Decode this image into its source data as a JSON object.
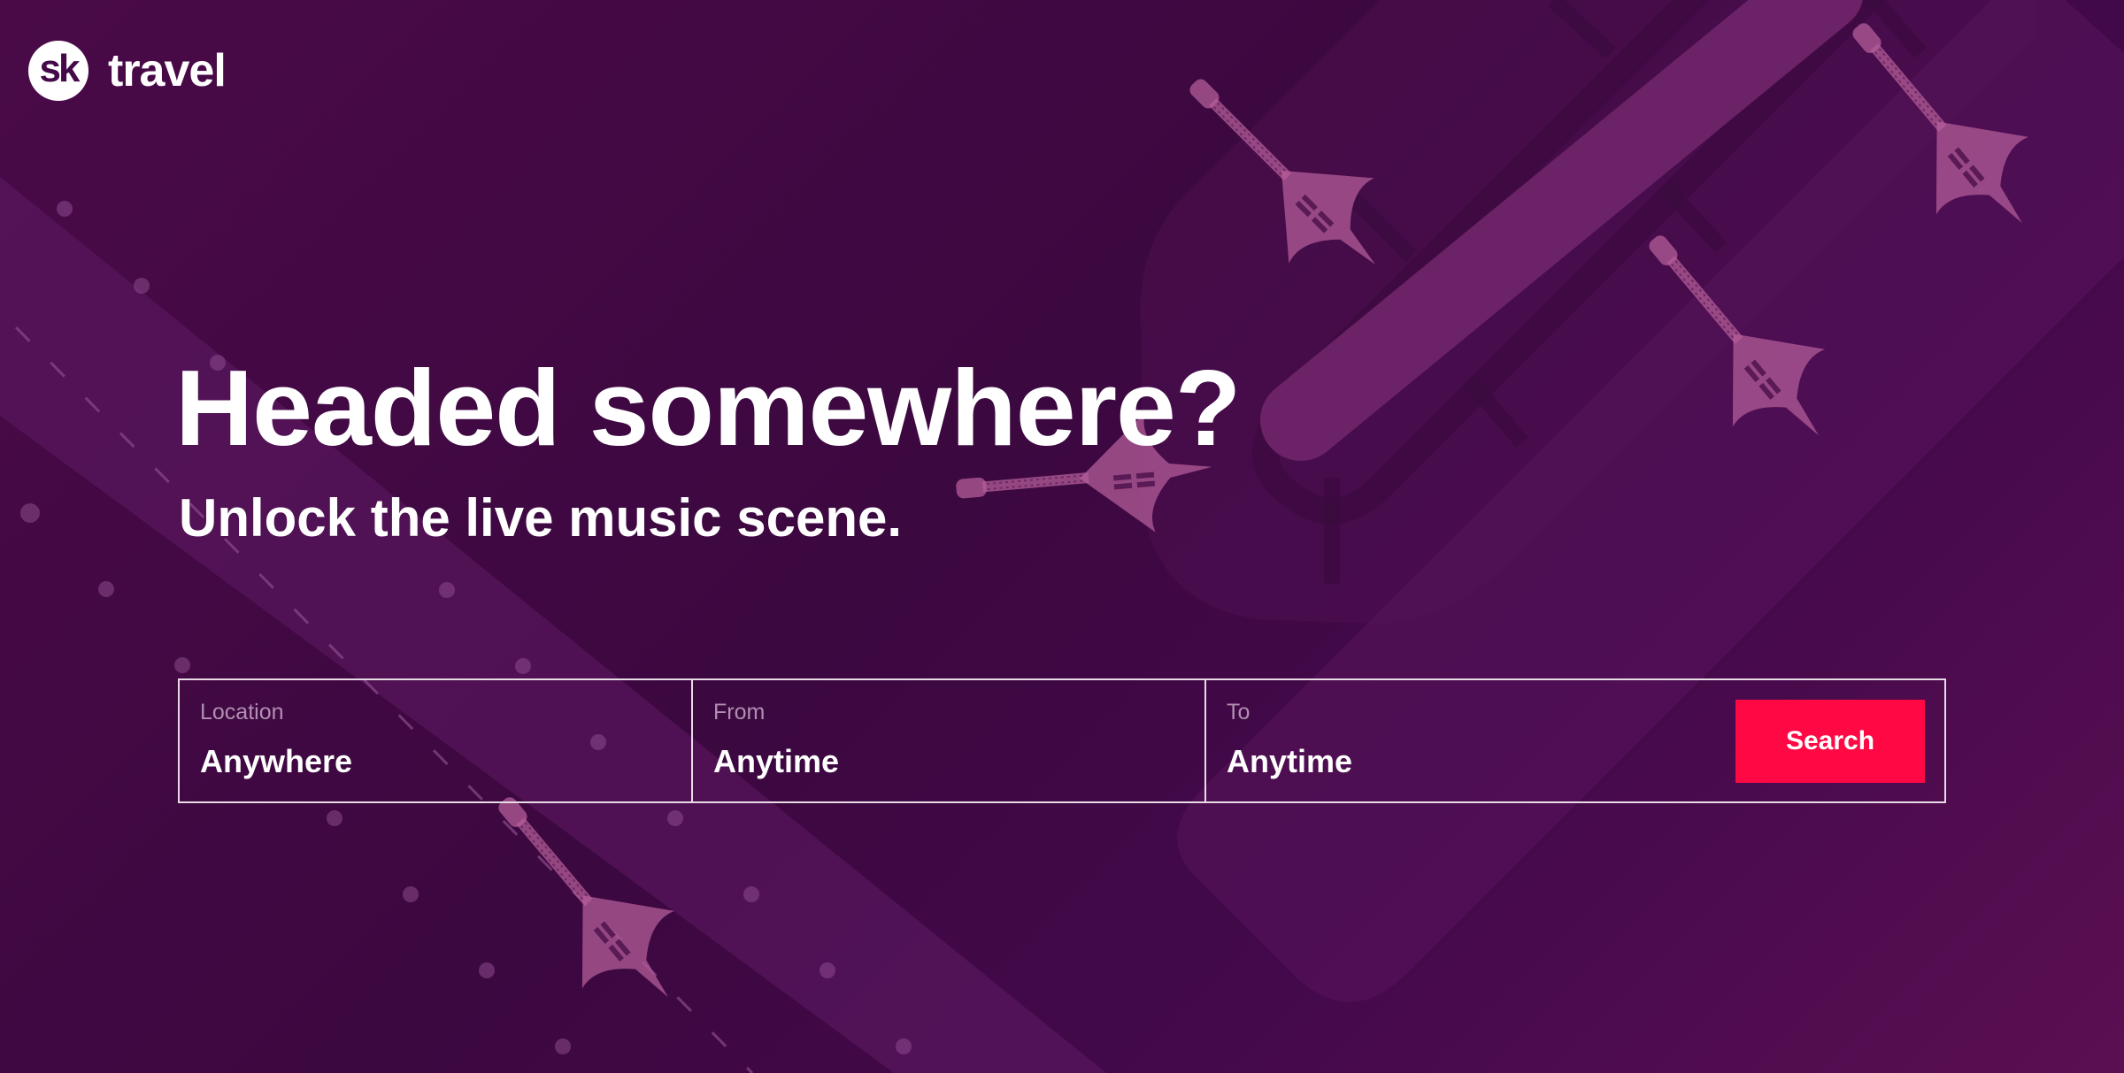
{
  "brand": {
    "logo_mark": "sk",
    "logo_word": "travel"
  },
  "hero": {
    "headline": "Headed somewhere?",
    "subhead": "Unlock the live music scene."
  },
  "search": {
    "fields": [
      {
        "label": "Location",
        "value": "Anywhere"
      },
      {
        "label": "From",
        "value": "Anytime"
      },
      {
        "label": "To",
        "value": "Anytime"
      }
    ],
    "button_label": "Search"
  },
  "colors": {
    "background": "#430945",
    "accent": "#ff0844",
    "field_border": "#e8dbe6",
    "field_label": "#b08fb1"
  },
  "icons": [
    "guitar-icon",
    "sk-logo-icon"
  ]
}
